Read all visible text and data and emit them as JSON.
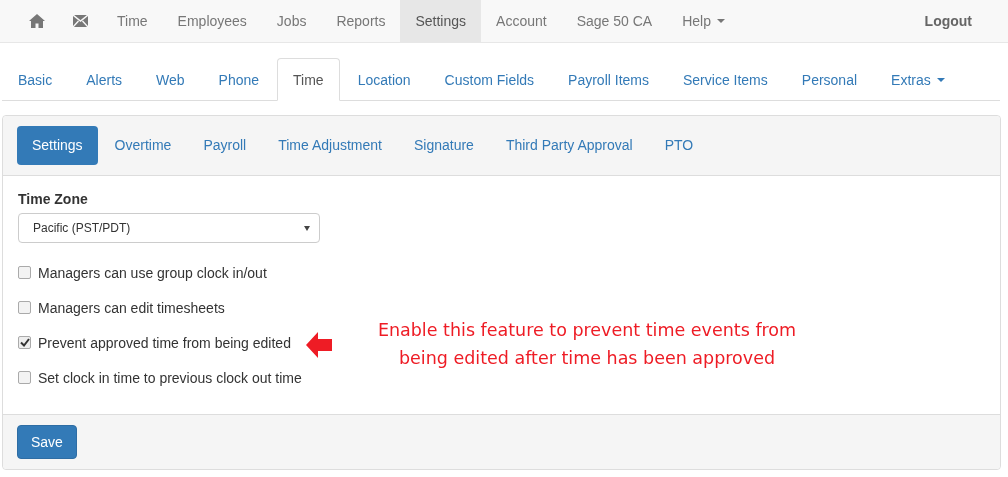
{
  "navbar": {
    "items": [
      {
        "label": "Time",
        "selected": false,
        "dropdown": false
      },
      {
        "label": "Employees",
        "selected": false,
        "dropdown": false
      },
      {
        "label": "Jobs",
        "selected": false,
        "dropdown": false
      },
      {
        "label": "Reports",
        "selected": false,
        "dropdown": false
      },
      {
        "label": "Settings",
        "selected": true,
        "dropdown": false
      },
      {
        "label": "Account",
        "selected": false,
        "dropdown": false
      },
      {
        "label": "Sage 50 CA",
        "selected": false,
        "dropdown": false
      },
      {
        "label": "Help",
        "selected": false,
        "dropdown": true
      }
    ],
    "logout": "Logout"
  },
  "tabs": [
    {
      "label": "Basic",
      "selected": false,
      "dropdown": false
    },
    {
      "label": "Alerts",
      "selected": false,
      "dropdown": false
    },
    {
      "label": "Web",
      "selected": false,
      "dropdown": false
    },
    {
      "label": "Phone",
      "selected": false,
      "dropdown": false
    },
    {
      "label": "Time",
      "selected": true,
      "dropdown": false
    },
    {
      "label": "Location",
      "selected": false,
      "dropdown": false
    },
    {
      "label": "Custom Fields",
      "selected": false,
      "dropdown": false
    },
    {
      "label": "Payroll Items",
      "selected": false,
      "dropdown": false
    },
    {
      "label": "Service Items",
      "selected": false,
      "dropdown": false
    },
    {
      "label": "Personal",
      "selected": false,
      "dropdown": false
    },
    {
      "label": "Extras",
      "selected": false,
      "dropdown": true
    }
  ],
  "subtabs": [
    {
      "label": "Settings",
      "selected": true
    },
    {
      "label": "Overtime",
      "selected": false
    },
    {
      "label": "Payroll",
      "selected": false
    },
    {
      "label": "Time Adjustment",
      "selected": false
    },
    {
      "label": "Signature",
      "selected": false
    },
    {
      "label": "Third Party Approval",
      "selected": false
    },
    {
      "label": "PTO",
      "selected": false
    }
  ],
  "time_zone": {
    "label": "Time Zone",
    "value": "Pacific (PST/PDT)"
  },
  "options": [
    {
      "label": "Managers can use group clock in/out",
      "checked": false
    },
    {
      "label": "Managers can edit timesheets",
      "checked": false
    },
    {
      "label": "Prevent approved time from being edited",
      "checked": true
    },
    {
      "label": "Set clock in time to previous clock out time",
      "checked": false
    }
  ],
  "annotation": {
    "text": "Enable this feature to prevent time events from being edited after time has been approved"
  },
  "save_button": "Save"
}
